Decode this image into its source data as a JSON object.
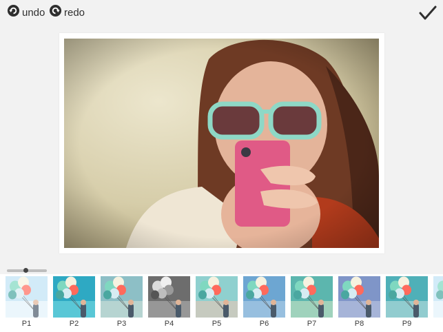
{
  "toolbar": {
    "undo_label": "undo",
    "redo_label": "redo",
    "done_icon": "checkmark-icon"
  },
  "editor": {
    "intensity": 0.47
  },
  "filters": [
    {
      "label": "P1",
      "sky": "#bfe3f5",
      "tint": "#ffffff",
      "shade": 0.15
    },
    {
      "label": "P2",
      "sky": "#2ea9c3",
      "tint": "#7ee0e6",
      "shade": 0
    },
    {
      "label": "P3",
      "sky": "#8dbfc6",
      "tint": "#d8e6da",
      "shade": 0
    },
    {
      "label": "P4",
      "sky": "#6d6d6d",
      "tint": "#b9b9b9",
      "shade": 1
    },
    {
      "label": "P5",
      "sky": "#8fd0cf",
      "tint": "#f4c4b2",
      "shade": 0
    },
    {
      "label": "P6",
      "sky": "#6da6d2",
      "tint": "#b9d3ea",
      "shade": 0
    },
    {
      "label": "P7",
      "sky": "#5cb6ae",
      "tint": "#d7e9c8",
      "shade": 0
    },
    {
      "label": "P8",
      "sky": "#7f95c8",
      "tint": "#c7cde6",
      "shade": 0
    },
    {
      "label": "P9",
      "sky": "#4fb0b8",
      "tint": "#c8e4e2",
      "shade": 0
    }
  ]
}
